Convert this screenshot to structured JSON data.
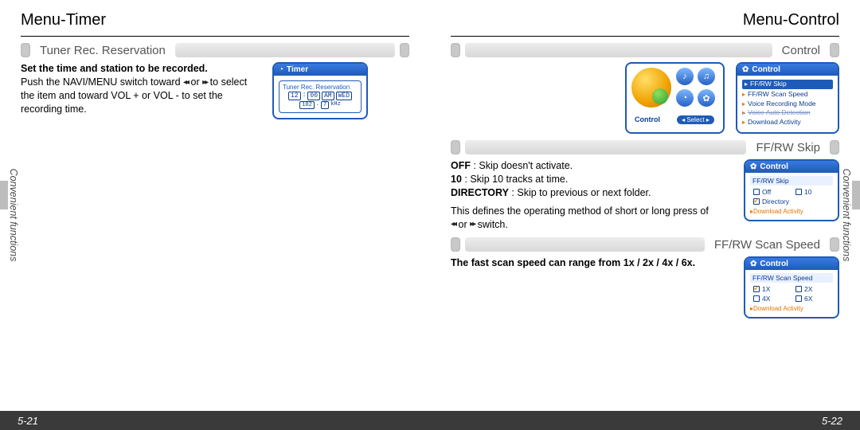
{
  "left": {
    "title": "Menu-Timer",
    "section": "Tuner Rec. Reservation",
    "bold_intro": "Set the time and station to be recorded.",
    "para_a": "Push the NAVI/MENU switch toward ",
    "para_b": " or ",
    "para_c": " to select the item and toward VOL + or VOL - to set the recording time.",
    "arrows_back": "◂◂",
    "arrows_fwd": "▸▸",
    "side_label": "Convenient functions",
    "page_num": "5-21",
    "timer_dev": {
      "hdr": "Timer",
      "sub": "Tuner Rec. Reservation",
      "row1": [
        "12",
        "00",
        "AM",
        "WED"
      ],
      "row2": [
        "102",
        "7",
        "kHz"
      ]
    }
  },
  "right": {
    "title": "Menu-Control",
    "section_control": "Control",
    "section_skip": "FF/RW Skip",
    "section_scan": "FF/RW Scan Speed",
    "side_label": "Convenient functions",
    "page_num": "5-22",
    "icons_dev": {
      "label": "Control",
      "select": "Select"
    },
    "menu_dev": {
      "hdr": "Control",
      "items": [
        "FF/RW Skip",
        "FF/RW Scan Speed",
        "Voice Recording Mode",
        "Voice Auto Detection",
        "Download Activity"
      ]
    },
    "skip_text": {
      "off_label": "OFF",
      "off_desc": " : Skip doesn't  activate.",
      "ten_label": "10",
      "ten_desc": " : Skip 10 tracks at time.",
      "dir_label": "DIRECTORY",
      "dir_desc": " : Skip to previous or next folder.",
      "defines": "This defines the operating method of short or long press of",
      "or": " or ",
      "switch": " switch."
    },
    "skip_dev": {
      "hdr": "Control",
      "title": "FF/RW Skip",
      "opts": [
        {
          "label": "Off",
          "checked": false
        },
        {
          "label": "10",
          "checked": false
        },
        {
          "label": "Directory",
          "checked": true
        }
      ],
      "dl": "Download Activity"
    },
    "scan_text": "The fast scan speed can range from 1x / 2x / 4x / 6x.",
    "scan_dev": {
      "hdr": "Control",
      "title": "FF/RW Scan Speed",
      "opts": [
        {
          "label": "1X",
          "checked": true
        },
        {
          "label": "2X",
          "checked": false
        },
        {
          "label": "4X",
          "checked": false
        },
        {
          "label": "6X",
          "checked": false
        }
      ],
      "dl": "Download Activity"
    }
  }
}
